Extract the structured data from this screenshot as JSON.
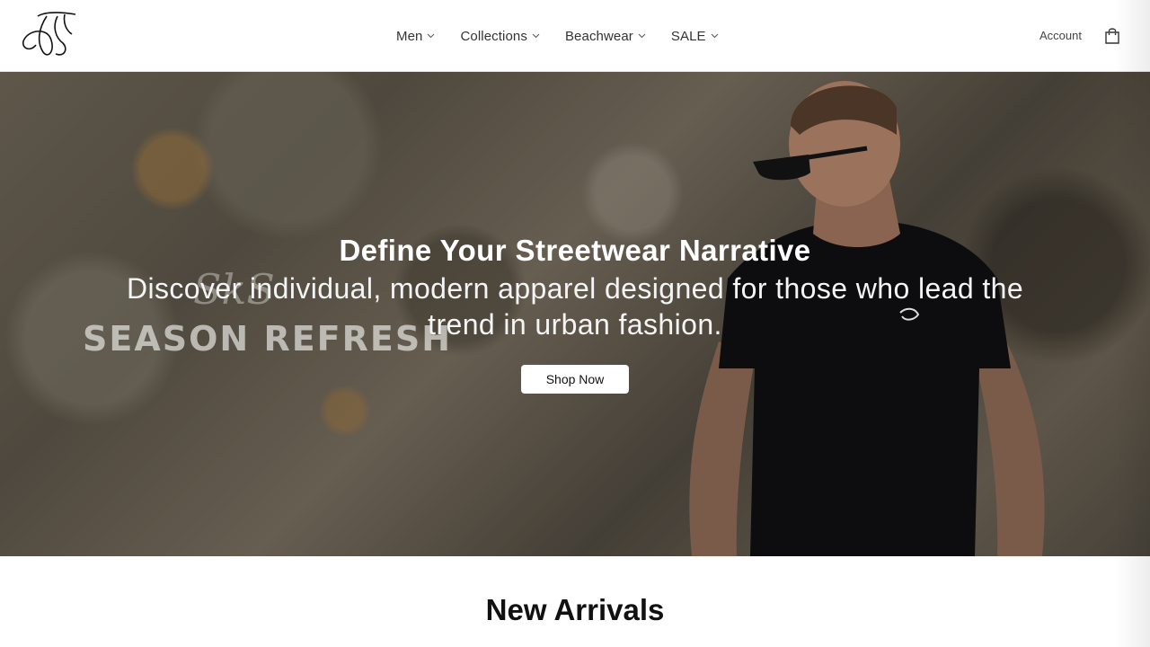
{
  "brand": {
    "logo_alt": "SikSilk",
    "accent": "#000000"
  },
  "header": {
    "nav": [
      {
        "label": "Men"
      },
      {
        "label": "Collections"
      },
      {
        "label": "Beachwear"
      },
      {
        "label": "SALE"
      }
    ],
    "account_label": "Account",
    "cart_icon": "shopping-bag-icon"
  },
  "hero": {
    "title": "Define Your Streetwear Narrative",
    "subtitle": "Discover individual, modern apparel designed for those who lead the trend in urban fashion.",
    "button_label": "Shop Now",
    "watermark_text": "SEASON REFRESH",
    "watermark_script": "SkS"
  },
  "sections": {
    "new_arrivals_title": "New Arrivals"
  }
}
